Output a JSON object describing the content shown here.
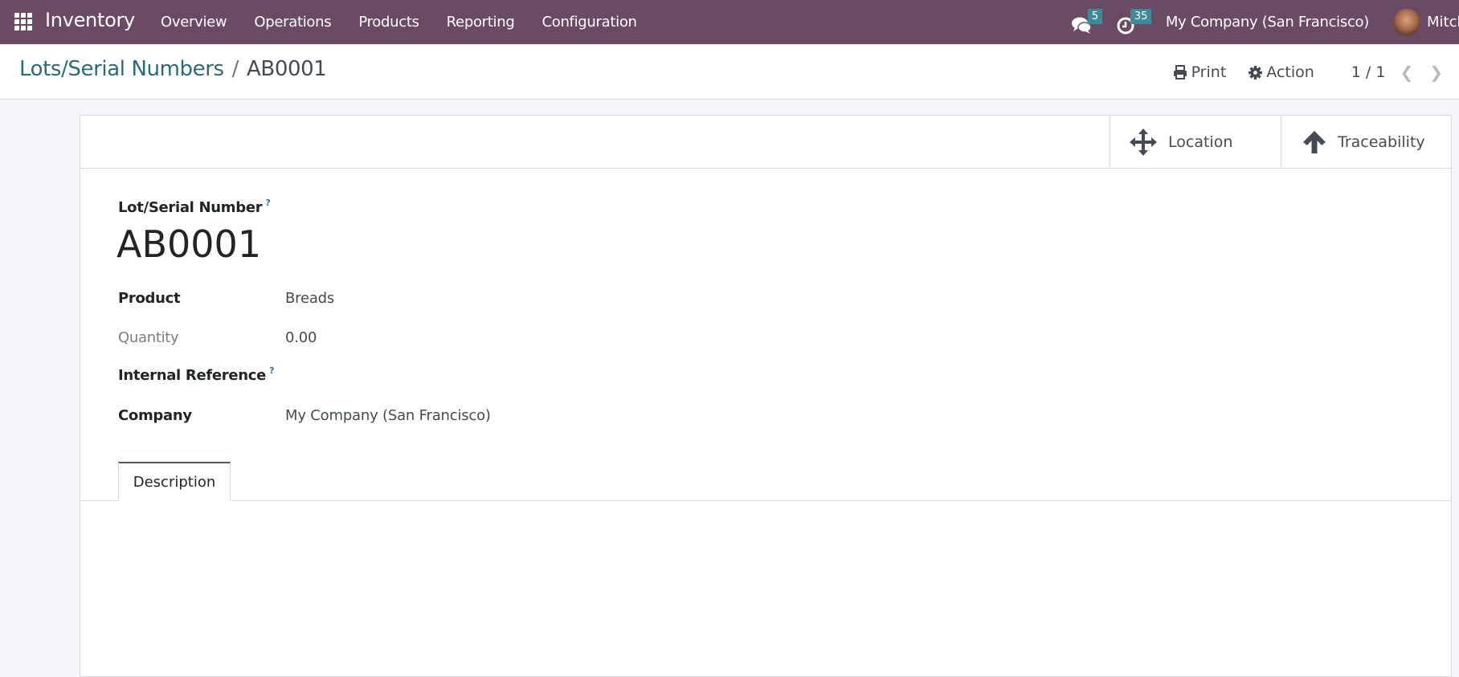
{
  "navbar": {
    "app_name": "Inventory",
    "menu": [
      "Overview",
      "Operations",
      "Products",
      "Reporting",
      "Configuration"
    ],
    "messages_count": "5",
    "activities_count": "35",
    "company": "My Company (San Francisco)",
    "user": "Mitch",
    "color": "#6b4a64"
  },
  "breadcrumb": {
    "parent": "Lots/Serial Numbers",
    "separator": "/",
    "current": "AB0001"
  },
  "control_panel": {
    "print_label": "Print",
    "action_label": "Action",
    "pager": "1 / 1"
  },
  "smart_buttons": {
    "location": "Location",
    "traceability": "Traceability"
  },
  "form": {
    "title_label": "Lot/Serial Number",
    "help_mark": "?",
    "title_value": "AB0001",
    "fields": [
      {
        "label": "Product",
        "value": "Breads"
      },
      {
        "label": "Quantity",
        "value": "0.00"
      },
      {
        "label": "Internal Reference",
        "value": ""
      },
      {
        "label": "Company",
        "value": "My Company (San Francisco)"
      }
    ]
  },
  "tabs": [
    {
      "label": "Description",
      "active": true
    }
  ]
}
